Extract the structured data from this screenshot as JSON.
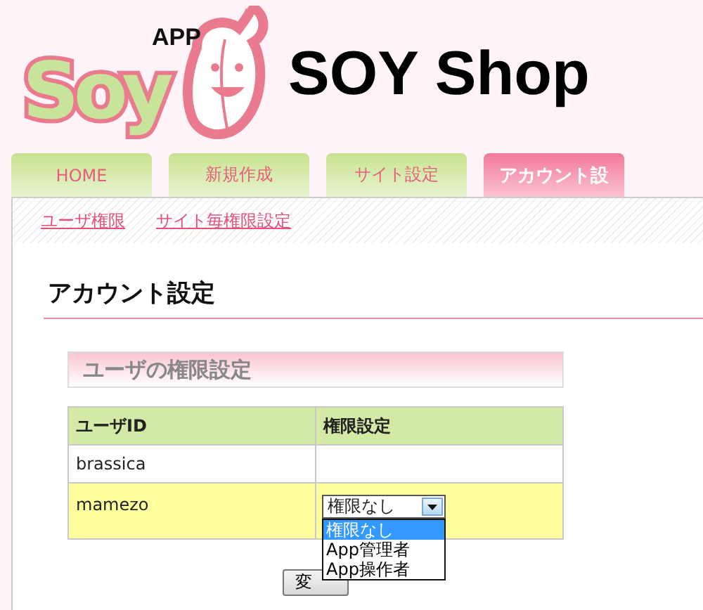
{
  "logo": {
    "small": "APP",
    "name": "Soy"
  },
  "site_title": "SOY Shop",
  "tabs": [
    {
      "label": "HOME",
      "selected": false
    },
    {
      "label": "新規作成",
      "selected": false
    },
    {
      "label": "サイト設定",
      "selected": false
    },
    {
      "label": "アカウント設",
      "selected": true
    }
  ],
  "subnav": [
    "ユーザ権限",
    "サイト毎権限設定"
  ],
  "page_heading": "アカウント設定",
  "section_heading": "ユーザの権限設定",
  "table": {
    "columns": [
      "ユーザID",
      "権限設定"
    ],
    "rows": [
      {
        "user": "brassica",
        "highlighted": false
      },
      {
        "user": "mamezo",
        "highlighted": true,
        "select": {
          "value": "権限なし",
          "expanded": true,
          "options": [
            {
              "label": "権限なし",
              "selected": true
            },
            {
              "label": "App管理者",
              "selected": false
            },
            {
              "label": "App操作者",
              "selected": false
            }
          ]
        }
      }
    ]
  },
  "submit_button": "変"
}
